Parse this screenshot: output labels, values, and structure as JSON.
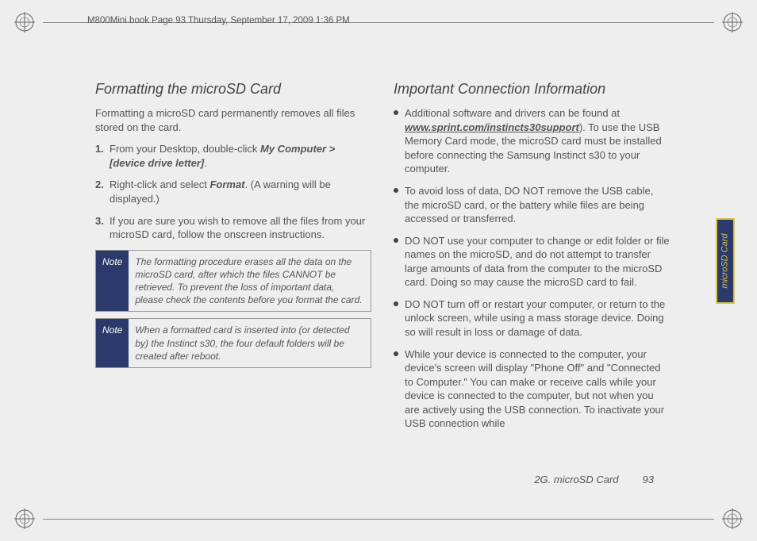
{
  "cropmark_header": "M800Mini.book  Page 93  Thursday, September 17, 2009  1:36 PM",
  "left": {
    "heading": "Formatting the microSD Card",
    "intro": "Formatting a microSD card permanently removes all files stored on the card.",
    "steps": {
      "s1a": "From your Desktop, double-click ",
      "s1b": "My Computer > [device drive letter]",
      "s1c": ".",
      "s2a": "Right-click and select ",
      "s2b": "Format",
      "s2c": ". (A warning will be displayed.)",
      "s3": "If you are sure you wish to remove all the files from your microSD card, follow the onscreen instructions."
    },
    "note_label": "Note",
    "note1": "The formatting procedure erases all the data on the microSD card, after which the files CANNOT be retrieved. To prevent the loss of important data, please check the contents before you format the card.",
    "note2": "When a formatted card is inserted into (or detected by) the Instinct s30, the four default folders will be created after reboot."
  },
  "right": {
    "heading": "Important Connection Information",
    "b1a": "Additional software and drivers can be found at ",
    "b1url": "www.sprint.com/instincts30support",
    "b1b": "). To use the USB Memory Card mode, the microSD card must be installed before connecting the Samsung Instinct s30 to your computer.",
    "b2": "To avoid loss of data, DO NOT remove the USB cable, the microSD card, or the battery while files are being accessed or transferred.",
    "b3": "DO NOT use your computer to change or edit folder or file names on the microSD, and do not attempt to transfer large amounts of data from the computer to the microSD card. Doing so may cause the microSD card to fail.",
    "b4": "DO NOT turn off or restart your computer, or return to the unlock screen, while using a mass storage device. Doing so will result in loss or damage of data.",
    "b5": "While your device is connected to the computer, your device's screen will display \"Phone Off\" and \"Connected to Computer.\" You can make or receive calls while your device is connected to the computer, but not when you are actively using the USB connection. To inactivate your USB connection while"
  },
  "sidetab": "microSD Card",
  "footer_section": "2G. microSD Card",
  "footer_page": "93"
}
